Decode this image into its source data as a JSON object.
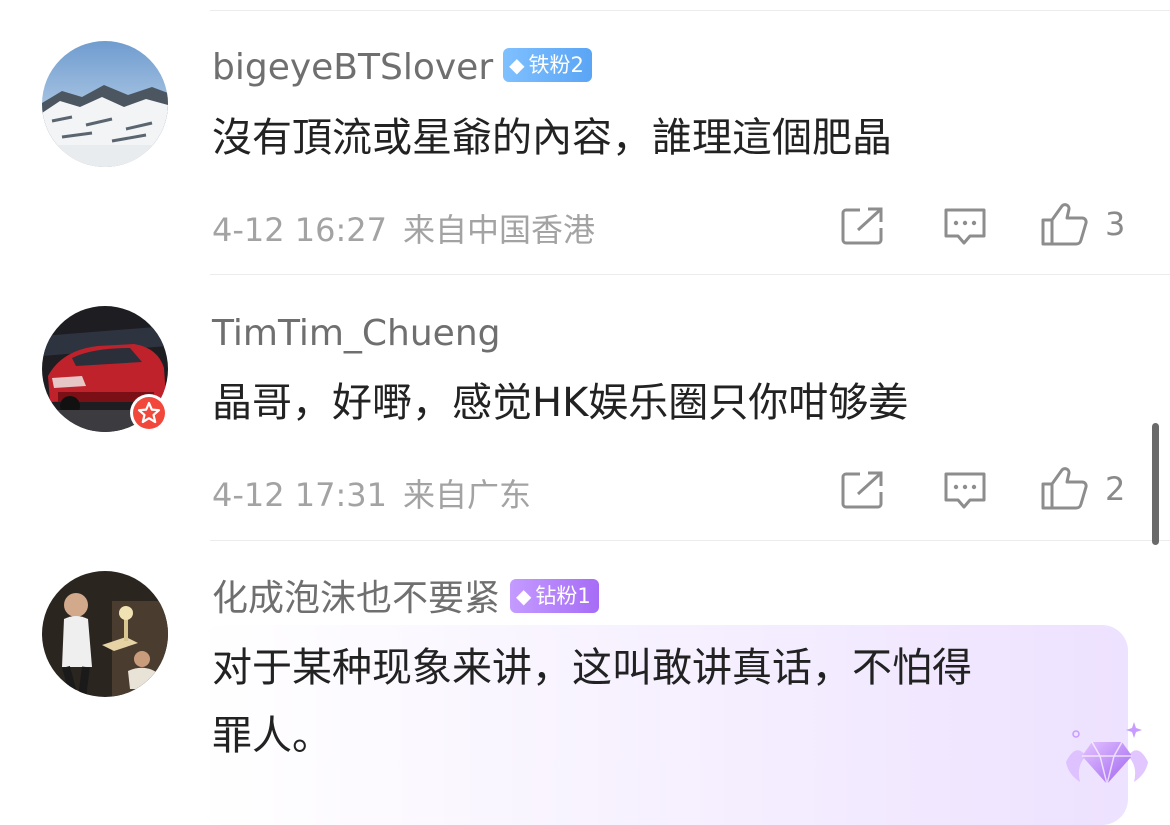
{
  "comments": [
    {
      "username": "bigeyeBTSlover",
      "badge": {
        "label": "铁粉2",
        "icon": "diamond-icon",
        "color": "#6ab2fb"
      },
      "text": "沒有頂流或星爺的內容，誰理這個肥晶",
      "time": "4-12 16:27",
      "location": "来自中国香港",
      "likes": "3"
    },
    {
      "username": "TimTim_Chueng",
      "badge": null,
      "text": "晶哥，好嘢，感觉HK娱乐圈只你咁够姜",
      "time": "4-12 17:31",
      "location": "来自广东",
      "likes": "2"
    },
    {
      "username": "化成泡沫也不要紧",
      "badge": {
        "label": "钻粉1",
        "icon": "diamond-icon",
        "color": "#b283fa"
      },
      "text_line1": "对于某种现象来讲，这叫敢讲真话，不怕得",
      "text_line2": "罪人。"
    }
  ],
  "icons": {
    "share": "share-icon",
    "reply": "comment-icon",
    "like": "thumbs-up-icon"
  }
}
